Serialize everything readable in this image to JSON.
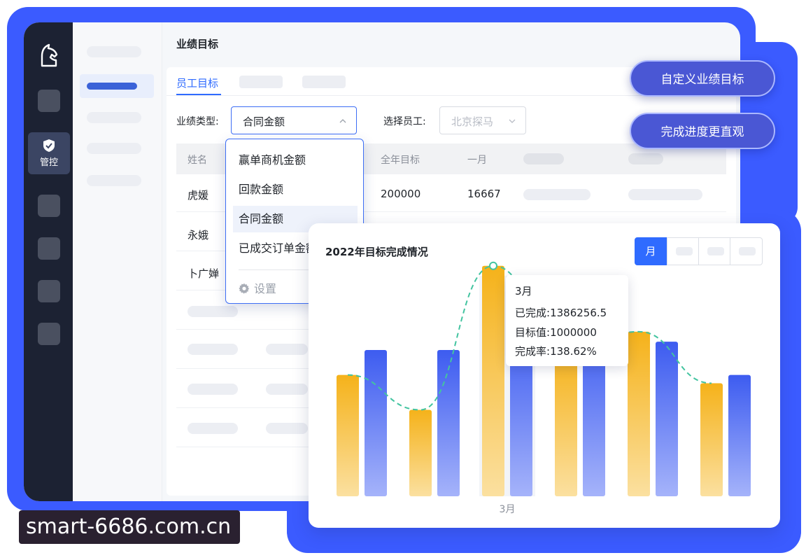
{
  "page": {
    "title": "业绩目标"
  },
  "sidebar": {
    "active_label": "管控"
  },
  "tabs": {
    "active": "员工目标"
  },
  "filters": {
    "type_label": "业绩类型:",
    "type_value": "合同金额",
    "employee_label": "选择员工:",
    "employee_placeholder": "北京探马"
  },
  "table": {
    "headers": {
      "name": "姓名",
      "annual": "全年目标",
      "jan": "一月"
    },
    "rows": [
      {
        "name": "虎媛",
        "annual": "200000",
        "jan": "16667"
      },
      {
        "name": "永娥"
      },
      {
        "name": "卜广婵"
      }
    ]
  },
  "dropdown": {
    "items": [
      "赢单商机金额",
      "回款金额",
      "合同金额",
      "已成交订单金额"
    ],
    "selected_index": 2,
    "settings_label": "设置"
  },
  "buttons": {
    "custom_goal": "自定义业绩目标",
    "progress": "完成进度更直观"
  },
  "chart": {
    "period_active": "月",
    "tooltip": {
      "title": "3月",
      "done_label": "已完成:",
      "done_value": "1386256.5",
      "target_label": "目标值:",
      "target_value": "1000000",
      "rate_label": "完成率:",
      "rate_value": "138.62%"
    }
  },
  "chart_data": {
    "type": "bar",
    "title": "2022年目标完成情况",
    "categories": [
      "",
      "",
      "3月",
      "",
      "",
      ""
    ],
    "series": [
      {
        "name": "已完成",
        "values": [
          730000,
          520000,
          1386256.5,
          880000,
          990000,
          680000
        ]
      },
      {
        "name": "目标值",
        "values": [
          880000,
          880000,
          1000000,
          990000,
          930000,
          730000
        ]
      }
    ],
    "line": {
      "values": [
        730000,
        520000,
        1386256.5,
        880000,
        990000,
        680000
      ]
    },
    "highlight_category": 2,
    "ylim": [
      0,
      1600000
    ],
    "grid": false,
    "colors": {
      "done": "#f5b21a",
      "target": "#3d5cf0",
      "line": "#43c4a0"
    }
  },
  "watermark": {
    "text": "smart-6686.com.cn"
  },
  "colors": {
    "accent": "#2f6bff",
    "sidebar": "#1c2233",
    "button": "#4a57d4"
  }
}
